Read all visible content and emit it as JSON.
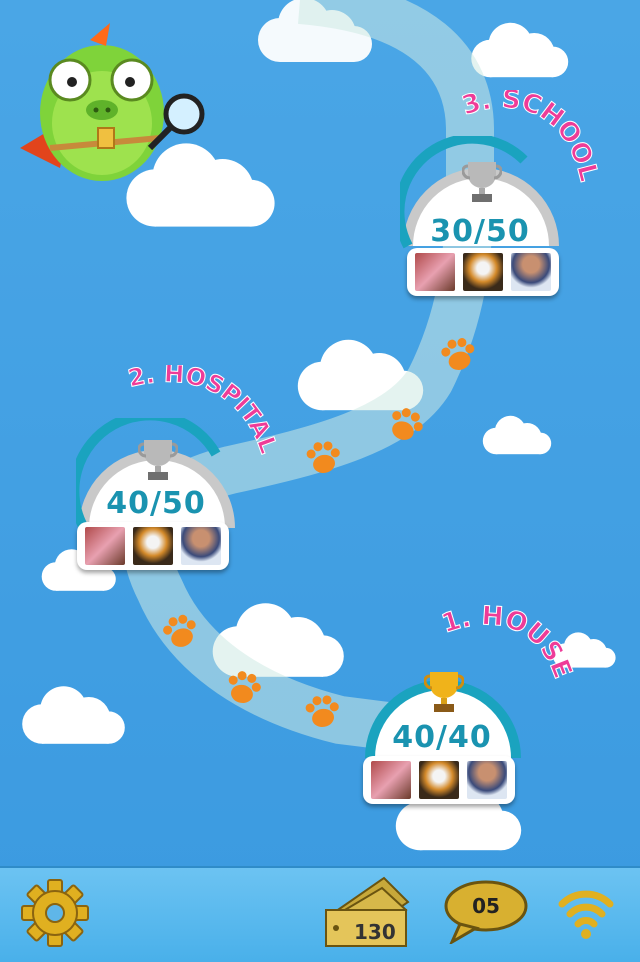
{
  "levels": [
    {
      "number_title": "1. HOUSE",
      "score": "40/40",
      "trophy": "gold-trophy-icon"
    },
    {
      "number_title": "2. HOSPITAL",
      "score": "40/50",
      "trophy": "silver-trophy-icon"
    },
    {
      "number_title": "3. SCHOOL",
      "score": "30/50",
      "trophy": "silver-trophy-icon"
    }
  ],
  "bottom_bar": {
    "settings_icon": "gear-icon",
    "tickets": "130",
    "messages": "05",
    "wifi_icon": "wifi-icon"
  },
  "colors": {
    "sky": "#3b9ae0",
    "ring": "#1a93b0",
    "title_pink": "#e8409a",
    "paw": "#f28a1e",
    "gold": "#f0b31a"
  }
}
